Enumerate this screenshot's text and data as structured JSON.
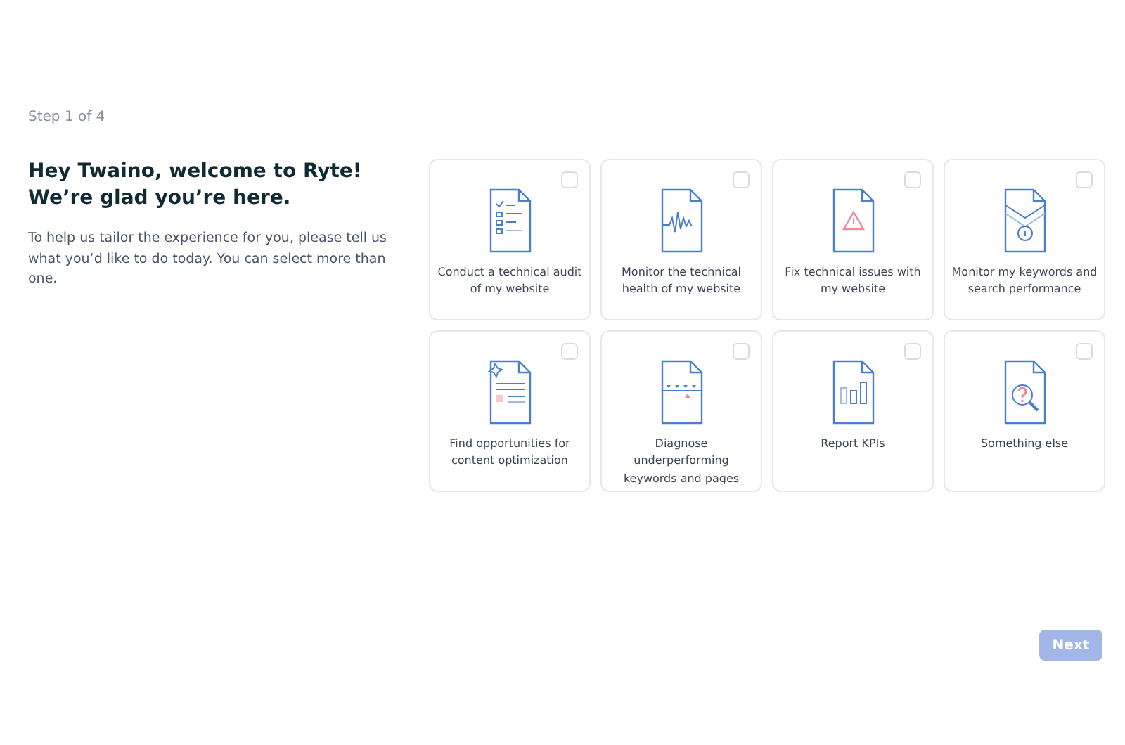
{
  "step": "Step 1 of 4",
  "heading": "Hey Twaino, welcome to Ryte! We’re glad you’re here.",
  "intro": "To help us tailor the experience for you, please tell us what you’d like to do today. You can select more than one.",
  "options": [
    {
      "kind": "audit",
      "label": "Conduct a technical audit of my website",
      "checked": false
    },
    {
      "kind": "health",
      "label": "Monitor the technical health of my website",
      "checked": false
    },
    {
      "kind": "issues",
      "label": "Fix technical issues with my website",
      "checked": false
    },
    {
      "kind": "keywords",
      "label": "Monitor my keywords and search performance",
      "checked": false
    },
    {
      "kind": "content",
      "label": "Find opportunities for content optimization",
      "checked": false
    },
    {
      "kind": "diagnose",
      "label": "Diagnose underperforming keywords and pages",
      "checked": false
    },
    {
      "kind": "kpis",
      "label": "Report KPIs",
      "checked": false
    },
    {
      "kind": "other",
      "label": "Something else",
      "checked": false
    }
  ],
  "next_button": {
    "label": "Next",
    "disabled": true
  }
}
